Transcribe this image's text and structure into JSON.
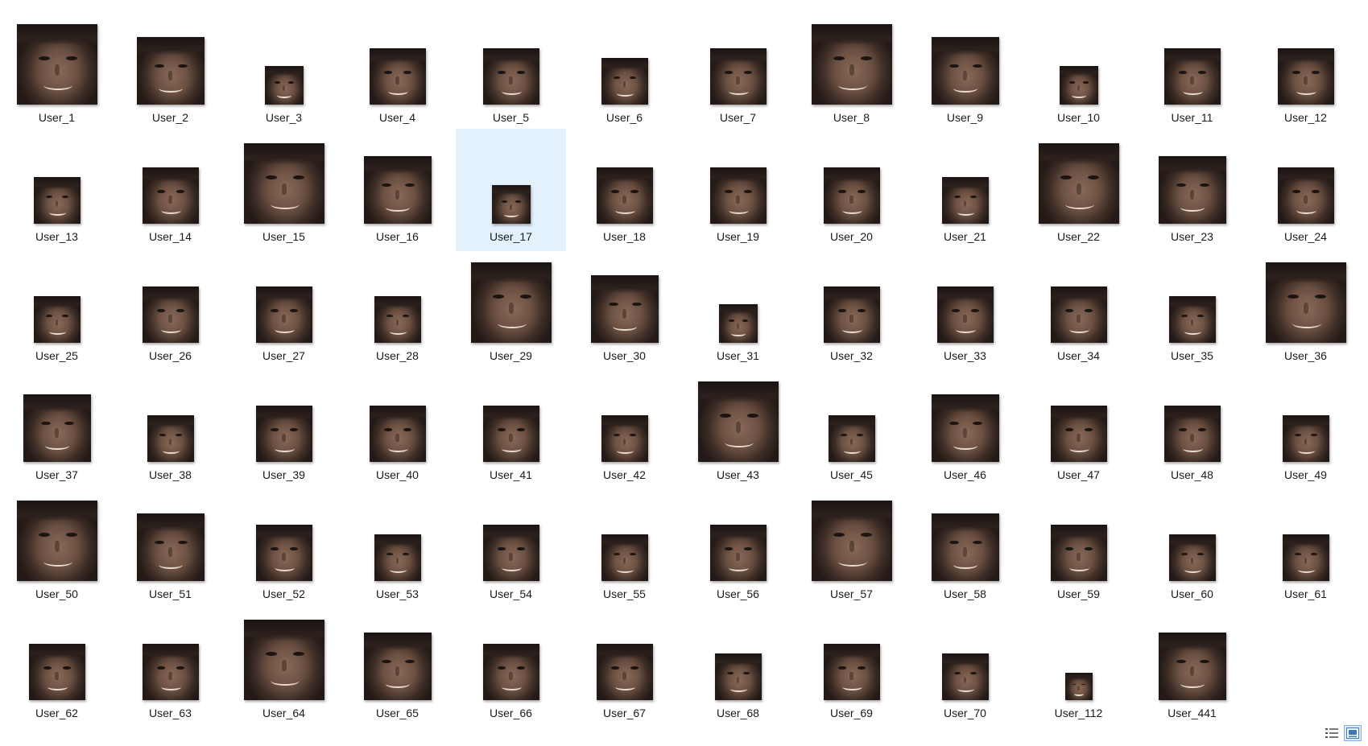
{
  "files": [
    {
      "name": "User_1",
      "size": "xl"
    },
    {
      "name": "User_2",
      "size": "l"
    },
    {
      "name": "User_3",
      "size": "s"
    },
    {
      "name": "User_4",
      "size": "m"
    },
    {
      "name": "User_5",
      "size": "m"
    },
    {
      "name": "User_6",
      "size": "sm"
    },
    {
      "name": "User_7",
      "size": "m"
    },
    {
      "name": "User_8",
      "size": "xl"
    },
    {
      "name": "User_9",
      "size": "l"
    },
    {
      "name": "User_10",
      "size": "s"
    },
    {
      "name": "User_11",
      "size": "m"
    },
    {
      "name": "User_12",
      "size": "m"
    },
    {
      "name": "User_13",
      "size": "sm"
    },
    {
      "name": "User_14",
      "size": "m"
    },
    {
      "name": "User_15",
      "size": "xl"
    },
    {
      "name": "User_16",
      "size": "l"
    },
    {
      "name": "User_17",
      "size": "s",
      "selected": true
    },
    {
      "name": "User_18",
      "size": "m"
    },
    {
      "name": "User_19",
      "size": "m"
    },
    {
      "name": "User_20",
      "size": "m"
    },
    {
      "name": "User_21",
      "size": "sm"
    },
    {
      "name": "User_22",
      "size": "xl"
    },
    {
      "name": "User_23",
      "size": "l"
    },
    {
      "name": "User_24",
      "size": "m"
    },
    {
      "name": "User_25",
      "size": "sm"
    },
    {
      "name": "User_26",
      "size": "m"
    },
    {
      "name": "User_27",
      "size": "m"
    },
    {
      "name": "User_28",
      "size": "sm"
    },
    {
      "name": "User_29",
      "size": "xl"
    },
    {
      "name": "User_30",
      "size": "l"
    },
    {
      "name": "User_31",
      "size": "s"
    },
    {
      "name": "User_32",
      "size": "m"
    },
    {
      "name": "User_33",
      "size": "m"
    },
    {
      "name": "User_34",
      "size": "m"
    },
    {
      "name": "User_35",
      "size": "sm"
    },
    {
      "name": "User_36",
      "size": "xl"
    },
    {
      "name": "User_37",
      "size": "l"
    },
    {
      "name": "User_38",
      "size": "sm"
    },
    {
      "name": "User_39",
      "size": "m"
    },
    {
      "name": "User_40",
      "size": "m"
    },
    {
      "name": "User_41",
      "size": "m"
    },
    {
      "name": "User_42",
      "size": "sm"
    },
    {
      "name": "User_43",
      "size": "xl"
    },
    {
      "name": "User_45",
      "size": "sm"
    },
    {
      "name": "User_46",
      "size": "l"
    },
    {
      "name": "User_47",
      "size": "m"
    },
    {
      "name": "User_48",
      "size": "m"
    },
    {
      "name": "User_49",
      "size": "sm"
    },
    {
      "name": "User_50",
      "size": "xl"
    },
    {
      "name": "User_51",
      "size": "l"
    },
    {
      "name": "User_52",
      "size": "m"
    },
    {
      "name": "User_53",
      "size": "sm"
    },
    {
      "name": "User_54",
      "size": "m"
    },
    {
      "name": "User_55",
      "size": "sm"
    },
    {
      "name": "User_56",
      "size": "m"
    },
    {
      "name": "User_57",
      "size": "xl"
    },
    {
      "name": "User_58",
      "size": "l"
    },
    {
      "name": "User_59",
      "size": "m"
    },
    {
      "name": "User_60",
      "size": "sm"
    },
    {
      "name": "User_61",
      "size": "sm"
    },
    {
      "name": "User_62",
      "size": "m"
    },
    {
      "name": "User_63",
      "size": "m"
    },
    {
      "name": "User_64",
      "size": "xl"
    },
    {
      "name": "User_65",
      "size": "l"
    },
    {
      "name": "User_66",
      "size": "m"
    },
    {
      "name": "User_67",
      "size": "m"
    },
    {
      "name": "User_68",
      "size": "sm"
    },
    {
      "name": "User_69",
      "size": "m"
    },
    {
      "name": "User_70",
      "size": "sm"
    },
    {
      "name": "User_112",
      "size": "xs"
    },
    {
      "name": "User_441",
      "size": "l"
    }
  ],
  "view_switch": [
    {
      "icon": "details-view-icon",
      "active": false
    },
    {
      "icon": "large-icons-view-icon",
      "active": true
    }
  ],
  "colors": {
    "selection": "#e3f1fd",
    "active_view": "#dcebfb"
  }
}
